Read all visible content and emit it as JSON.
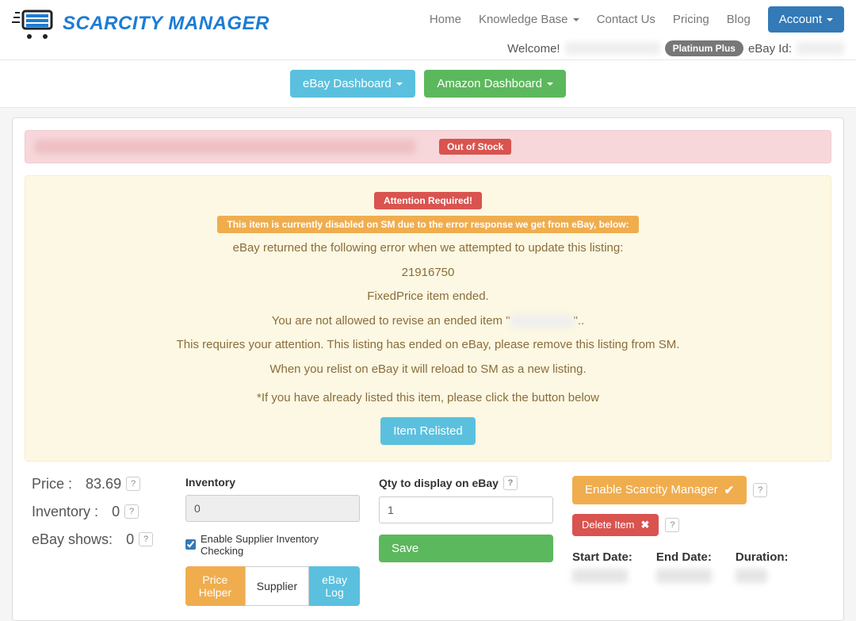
{
  "brand": "SCARCITY MANAGER",
  "nav": {
    "home": "Home",
    "kb": "Knowledge Base",
    "contact": "Contact Us",
    "pricing": "Pricing",
    "blog": "Blog",
    "account": "Account"
  },
  "welcome": {
    "label": "Welcome!",
    "plan": "Platinum Plus",
    "ebay_id_label": "eBay Id:"
  },
  "dash": {
    "ebay": "eBay Dashboard",
    "amazon": "Amazon Dashboard"
  },
  "stock_badge": "Out of Stock",
  "alert": {
    "attention": "Attention Required!",
    "disabled": "This item is currently disabled on SM due to the error response we get from eBay, below:",
    "line1": "eBay returned the following error when we attempted to update this listing:",
    "code": "21916750",
    "line2": "FixedPrice item ended.",
    "line3a": "You are not allowed to revise an ended item \"",
    "line3b": "\"..",
    "line4": "This requires your attention. This listing has ended on eBay, please remove this listing from SM.",
    "line5": "When you relist on eBay it will reload to SM as a new listing.",
    "already": "*If you have already listed this item, please click the button below",
    "relisted_btn": "Item Relisted"
  },
  "summary": {
    "price_label": "Price :",
    "price_value": "83.69",
    "inventory_label": "Inventory :",
    "inventory_value": "0",
    "ebay_shows_label": "eBay shows:",
    "ebay_shows_value": "0"
  },
  "form": {
    "inventory_label": "Inventory",
    "inventory_value": "0",
    "qty_label": "Qty to display on eBay",
    "qty_value": "1",
    "supplier_check": "Enable Supplier Inventory Checking",
    "save": "Save",
    "price_helper": "Price Helper",
    "supplier": "Supplier",
    "ebay_log": "eBay Log"
  },
  "actions": {
    "enable_sm": "Enable Scarcity Manager",
    "delete": "Delete Item"
  },
  "dates": {
    "start": "Start Date:",
    "end": "End Date:",
    "duration": "Duration:"
  }
}
